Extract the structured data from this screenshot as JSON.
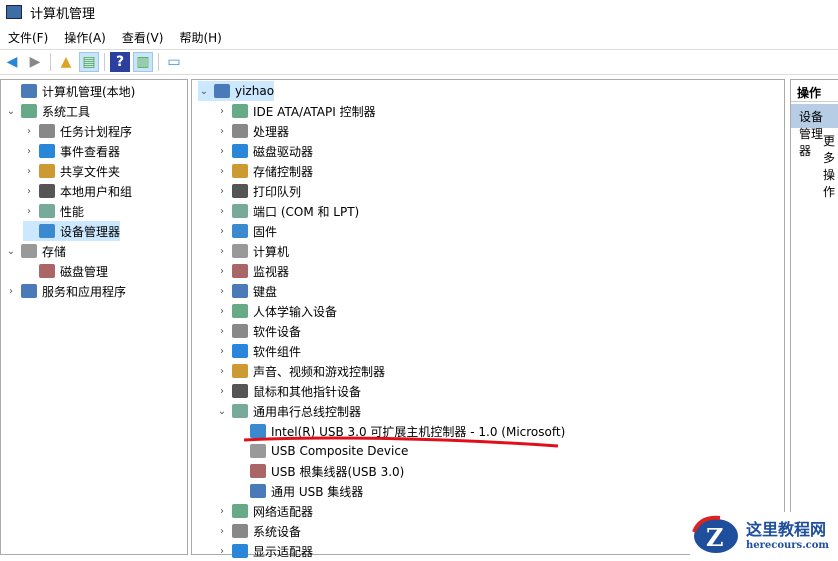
{
  "window": {
    "title": "计算机管理"
  },
  "menu": [
    "文件(F)",
    "操作(A)",
    "查看(V)",
    "帮助(H)"
  ],
  "left_tree": [
    {
      "label": "计算机管理(本地)",
      "level": 0,
      "chev": ""
    },
    {
      "label": "系统工具",
      "level": 0,
      "chev": "v"
    },
    {
      "label": "任务计划程序",
      "level": 1,
      "chev": ">"
    },
    {
      "label": "事件查看器",
      "level": 1,
      "chev": ">"
    },
    {
      "label": "共享文件夹",
      "level": 1,
      "chev": ">"
    },
    {
      "label": "本地用户和组",
      "level": 1,
      "chev": ">"
    },
    {
      "label": "性能",
      "level": 1,
      "chev": ">"
    },
    {
      "label": "设备管理器",
      "level": 1,
      "chev": "",
      "selected": true
    },
    {
      "label": "存储",
      "level": 0,
      "chev": "v"
    },
    {
      "label": "磁盘管理",
      "level": 1,
      "chev": ""
    },
    {
      "label": "服务和应用程序",
      "level": 0,
      "chev": ">"
    }
  ],
  "device_tree": [
    {
      "label": "yizhao",
      "level": 0,
      "chev": "v",
      "selected": true
    },
    {
      "label": "IDE ATA/ATAPI 控制器",
      "level": 1,
      "chev": ">"
    },
    {
      "label": "处理器",
      "level": 1,
      "chev": ">"
    },
    {
      "label": "磁盘驱动器",
      "level": 1,
      "chev": ">"
    },
    {
      "label": "存储控制器",
      "level": 1,
      "chev": ">"
    },
    {
      "label": "打印队列",
      "level": 1,
      "chev": ">"
    },
    {
      "label": "端口 (COM 和 LPT)",
      "level": 1,
      "chev": ">"
    },
    {
      "label": "固件",
      "level": 1,
      "chev": ">"
    },
    {
      "label": "计算机",
      "level": 1,
      "chev": ">"
    },
    {
      "label": "监视器",
      "level": 1,
      "chev": ">"
    },
    {
      "label": "键盘",
      "level": 1,
      "chev": ">"
    },
    {
      "label": "人体学输入设备",
      "level": 1,
      "chev": ">"
    },
    {
      "label": "软件设备",
      "level": 1,
      "chev": ">"
    },
    {
      "label": "软件组件",
      "level": 1,
      "chev": ">"
    },
    {
      "label": "声音、视频和游戏控制器",
      "level": 1,
      "chev": ">"
    },
    {
      "label": "鼠标和其他指针设备",
      "level": 1,
      "chev": ">"
    },
    {
      "label": "通用串行总线控制器",
      "level": 1,
      "chev": "v"
    },
    {
      "label": "Intel(R) USB 3.0 可扩展主机控制器 - 1.0 (Microsoft)",
      "level": 2,
      "chev": ""
    },
    {
      "label": "USB Composite Device",
      "level": 2,
      "chev": ""
    },
    {
      "label": "USB 根集线器(USB 3.0)",
      "level": 2,
      "chev": ""
    },
    {
      "label": "通用 USB 集线器",
      "level": 2,
      "chev": ""
    },
    {
      "label": "网络适配器",
      "level": 1,
      "chev": ">"
    },
    {
      "label": "系统设备",
      "level": 1,
      "chev": ">"
    },
    {
      "label": "显示适配器",
      "level": 1,
      "chev": ">"
    }
  ],
  "actions": {
    "header": "操作",
    "selected": "设备管理器",
    "sub": "更多操作"
  },
  "watermark": {
    "title": "这里教程网",
    "url": "herecours.com"
  },
  "colors": {
    "selection": "#cce8ff",
    "action_sel": "#b7cde6",
    "annotation": "#e0101a"
  }
}
